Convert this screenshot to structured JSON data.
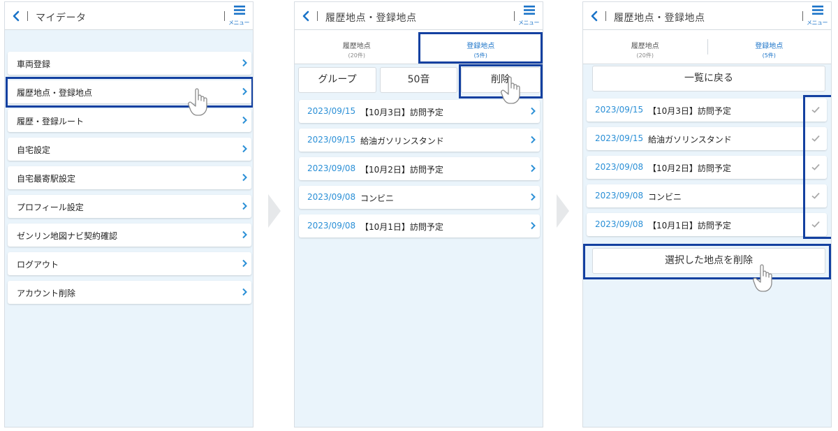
{
  "screen1": {
    "title": "マイデータ",
    "menu_label": "メニュー",
    "items": [
      {
        "label": "車両登録"
      },
      {
        "label": "履歴地点・登録地点"
      },
      {
        "label": "履歴・登録ルート"
      },
      {
        "label": "自宅設定"
      },
      {
        "label": "自宅最寄駅設定"
      },
      {
        "label": "プロフィール設定"
      },
      {
        "label": "ゼンリン地図ナビ契約確認"
      },
      {
        "label": "ログアウト"
      },
      {
        "label": "アカウント削除"
      }
    ]
  },
  "screen2": {
    "title": "履歴地点・登録地点",
    "menu_label": "メニュー",
    "tabs": [
      {
        "label": "履歴地点",
        "count": "(20件)"
      },
      {
        "label": "登録地点",
        "count": "(5件)"
      }
    ],
    "buttons": {
      "group": "グループ",
      "kana": "50音",
      "delete": "削除"
    },
    "records": [
      {
        "date": "2023/09/15",
        "name": "【10月3日】訪問予定"
      },
      {
        "date": "2023/09/15",
        "name": "給油ガソリンスタンド"
      },
      {
        "date": "2023/09/08",
        "name": "【10月2日】訪問予定"
      },
      {
        "date": "2023/09/08",
        "name": "コンビニ"
      },
      {
        "date": "2023/09/08",
        "name": "【10月1日】訪問予定"
      }
    ]
  },
  "screen3": {
    "title": "履歴地点・登録地点",
    "menu_label": "メニュー",
    "tabs": [
      {
        "label": "履歴地点",
        "count": "(20件)"
      },
      {
        "label": "登録地点",
        "count": "(5件)"
      }
    ],
    "back_to_list": "一覧に戻る",
    "delete_selected": "選択した地点を削除",
    "records": [
      {
        "date": "2023/09/15",
        "name": "【10月3日】訪問予定"
      },
      {
        "date": "2023/09/15",
        "name": "給油ガソリンスタンド"
      },
      {
        "date": "2023/09/08",
        "name": "【10月2日】訪問予定"
      },
      {
        "date": "2023/09/08",
        "name": "コンビニ"
      },
      {
        "date": "2023/09/08",
        "name": "【10月1日】訪問予定"
      }
    ]
  },
  "colors": {
    "accent": "#1a73c8",
    "date_text": "#2a8fd6",
    "highlight": "#1340a0",
    "background": "#eaf4fb"
  },
  "icons": {
    "back": "chevron-left-icon",
    "menu": "hamburger-menu-icon",
    "row": "chevron-right-icon",
    "check": "checkmark-icon",
    "pointer": "pointing-hand-icon",
    "step": "step-arrow-icon"
  }
}
